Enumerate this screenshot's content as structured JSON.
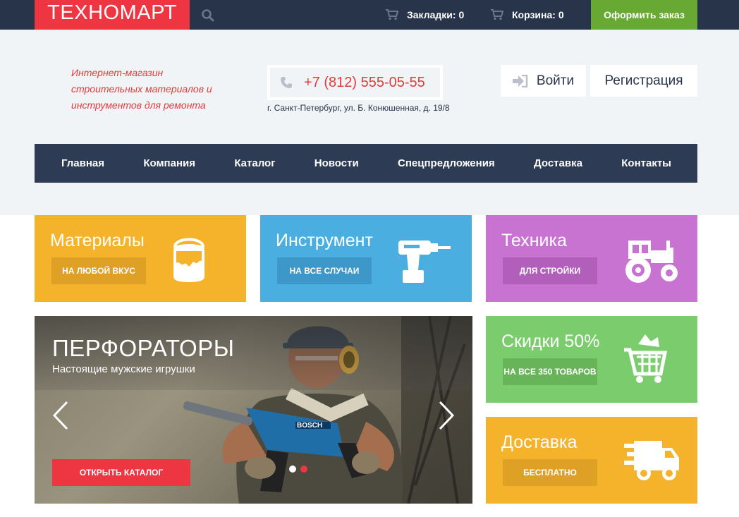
{
  "topbar": {
    "logo": "ТЕХНОМАРТ",
    "search_icon": "search-icon",
    "bookmarks": "Закладки: 0",
    "cart": "Корзина: 0",
    "order_button": "Оформить заказ"
  },
  "header": {
    "tagline_line1": "Интернет-магазин",
    "tagline_line2": "строительных материалов и",
    "tagline_line3": "инструментов для ремонта",
    "phone": "+7 (812) 555-05-55",
    "address": "г. Санкт-Петербург, ул. Б. Конюшенная, д. 19/8",
    "login": "Войти",
    "register": "Регистрация"
  },
  "nav": {
    "items": [
      "Главная",
      "Компания",
      "Каталог",
      "Новости",
      "Спецпредложения",
      "Доставка",
      "Контакты"
    ]
  },
  "tiles": {
    "materials": {
      "title": "Материалы",
      "button": "НА ЛЮБОЙ ВКУС",
      "icon": "paint-bucket-icon"
    },
    "tools": {
      "title": "Инструмент",
      "button": "НА ВСЕ СЛУЧАИ",
      "icon": "drill-icon"
    },
    "tech": {
      "title": "Техника",
      "button": "ДЛЯ СТРОЙКИ",
      "icon": "tractor-icon"
    },
    "sale": {
      "title": "Скидки 50%",
      "button": "НА ВСЕ 350 ТОВАРОВ",
      "icon": "shopping-cart-icon"
    },
    "delivery": {
      "title": "Доставка",
      "button": "БЕСПЛАТНО",
      "icon": "truck-icon"
    }
  },
  "slider": {
    "title": "ПЕРФОРАТОРЫ",
    "subtitle": "Настоящие мужские игрушки",
    "button": "ОТКРЫТЬ КАТАЛОГ",
    "brand": "BOSCH",
    "slides_count": 2,
    "active_slide": 2
  },
  "colors": {
    "brand_red": "#ee3643",
    "dark_navy": "#283449",
    "green": "#68a934",
    "yellow": "#f5b32c",
    "blue": "#4aafe0",
    "purple": "#c873d2",
    "light_green": "#7bcc6c"
  }
}
